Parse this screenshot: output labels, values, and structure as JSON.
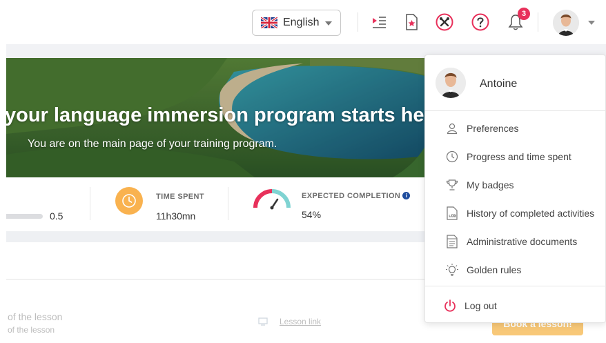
{
  "topbar": {
    "language": "English",
    "notification_count": "3",
    "icons": [
      "playlist-icon",
      "bookmark-star-icon",
      "tools-icon",
      "help-icon",
      "bell-icon"
    ]
  },
  "hero": {
    "title": "your language immersion program starts here",
    "subtitle": "You are on the main page of your training program."
  },
  "stats": {
    "progress_value": "0.5",
    "time_spent_label": "TIME SPENT",
    "time_spent_value": "11h30mn",
    "completion_label": "EXPECTED COMPLETION",
    "completion_value": "54%"
  },
  "lesson": {
    "line1": "of the lesson",
    "line2": "of the lesson",
    "lesson_link": "Lesson link",
    "book_button": "Book a lesson!"
  },
  "user_menu": {
    "name": "Antoine",
    "items": [
      {
        "label": "Preferences",
        "icon": "user-icon"
      },
      {
        "label": "Progress and time spent",
        "icon": "clock-icon"
      },
      {
        "label": "My badges",
        "icon": "trophy-icon"
      },
      {
        "label": "History of completed activities",
        "icon": "log-file-icon"
      },
      {
        "label": "Administrative documents",
        "icon": "document-icon"
      },
      {
        "label": "Golden rules",
        "icon": "lightbulb-icon"
      }
    ],
    "logout": "Log out"
  },
  "colors": {
    "accent_pink": "#e8315b",
    "clock_orange": "#f9b24f",
    "gauge_teal": "#7fd3d2",
    "book_button": "#f8c878"
  }
}
